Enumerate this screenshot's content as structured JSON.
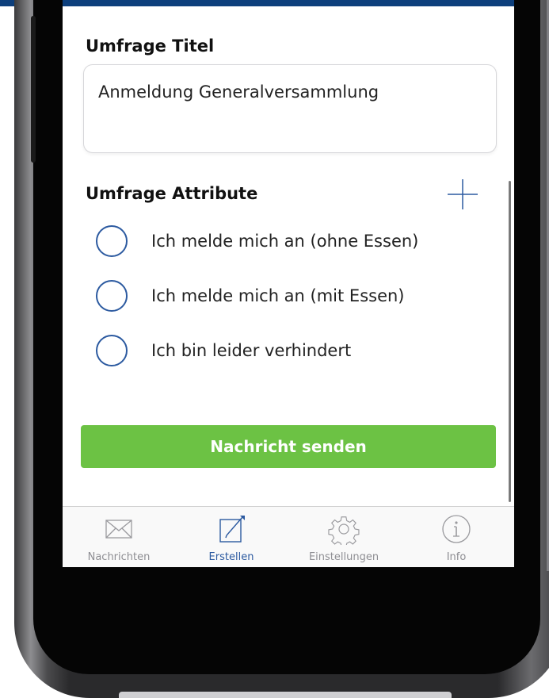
{
  "form": {
    "title_heading": "Umfrage Titel",
    "title_value": "Anmeldung Generalversammlung",
    "attributes_heading": "Umfrage Attribute",
    "add_icon": "plus-icon",
    "options": [
      {
        "label": "Ich melde mich an (ohne Essen)"
      },
      {
        "label": "Ich melde mich an (mit Essen)"
      },
      {
        "label": "Ich bin leider verhindert"
      }
    ],
    "send_label": "Nachricht senden"
  },
  "tabbar": {
    "active": "Erstellen",
    "tabs": [
      {
        "label": "Nachrichten",
        "icon": "envelope-icon"
      },
      {
        "label": "Erstellen",
        "icon": "compose-icon"
      },
      {
        "label": "Einstellungen",
        "icon": "gear-icon"
      },
      {
        "label": "Info",
        "icon": "info-icon"
      }
    ]
  },
  "colors": {
    "header_blue": "#0d3f7c",
    "accent_blue": "#2c5aa0",
    "send_green": "#6cc244",
    "inactive_gray": "#8e8e93"
  }
}
